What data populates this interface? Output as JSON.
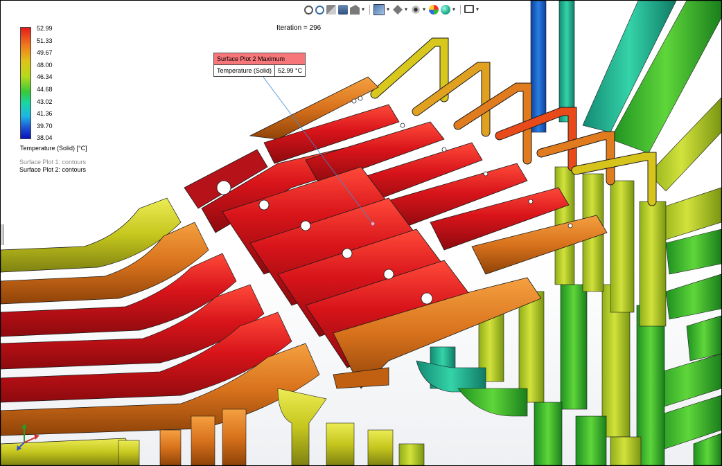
{
  "iteration_label": "Iteration = 296",
  "legend": {
    "values": [
      "52.99",
      "51.33",
      "49.67",
      "48.00",
      "46.34",
      "44.68",
      "43.02",
      "41.36",
      "39.70",
      "38.04"
    ],
    "title": "Temperature (Solid) [°C]",
    "colors": [
      "#e41b1b",
      "#f07a1e",
      "#e0c21a",
      "#b7d91c",
      "#38c93a",
      "#18d6a2",
      "#1eb5e5",
      "#1e55d6",
      "#0b10b8"
    ]
  },
  "surface_plots": [
    "Surface Plot 1: contours",
    "Surface Plot 2: contours"
  ],
  "probe": {
    "title": "Surface Plot 2 Maximum",
    "label": "Temperature (Solid)",
    "value": "52.99 °C"
  },
  "toolbar": {
    "icons": [
      "zoom-to-fit-icon",
      "zoom-to-area-icon",
      "previous-view-icon",
      "section-view-icon",
      "dynamic-annotation-icon",
      "view-orientation-icon",
      "display-style-icon",
      "hide-show-icon",
      "edit-appearance-icon",
      "apply-scene-icon",
      "view-settings-icon"
    ]
  }
}
